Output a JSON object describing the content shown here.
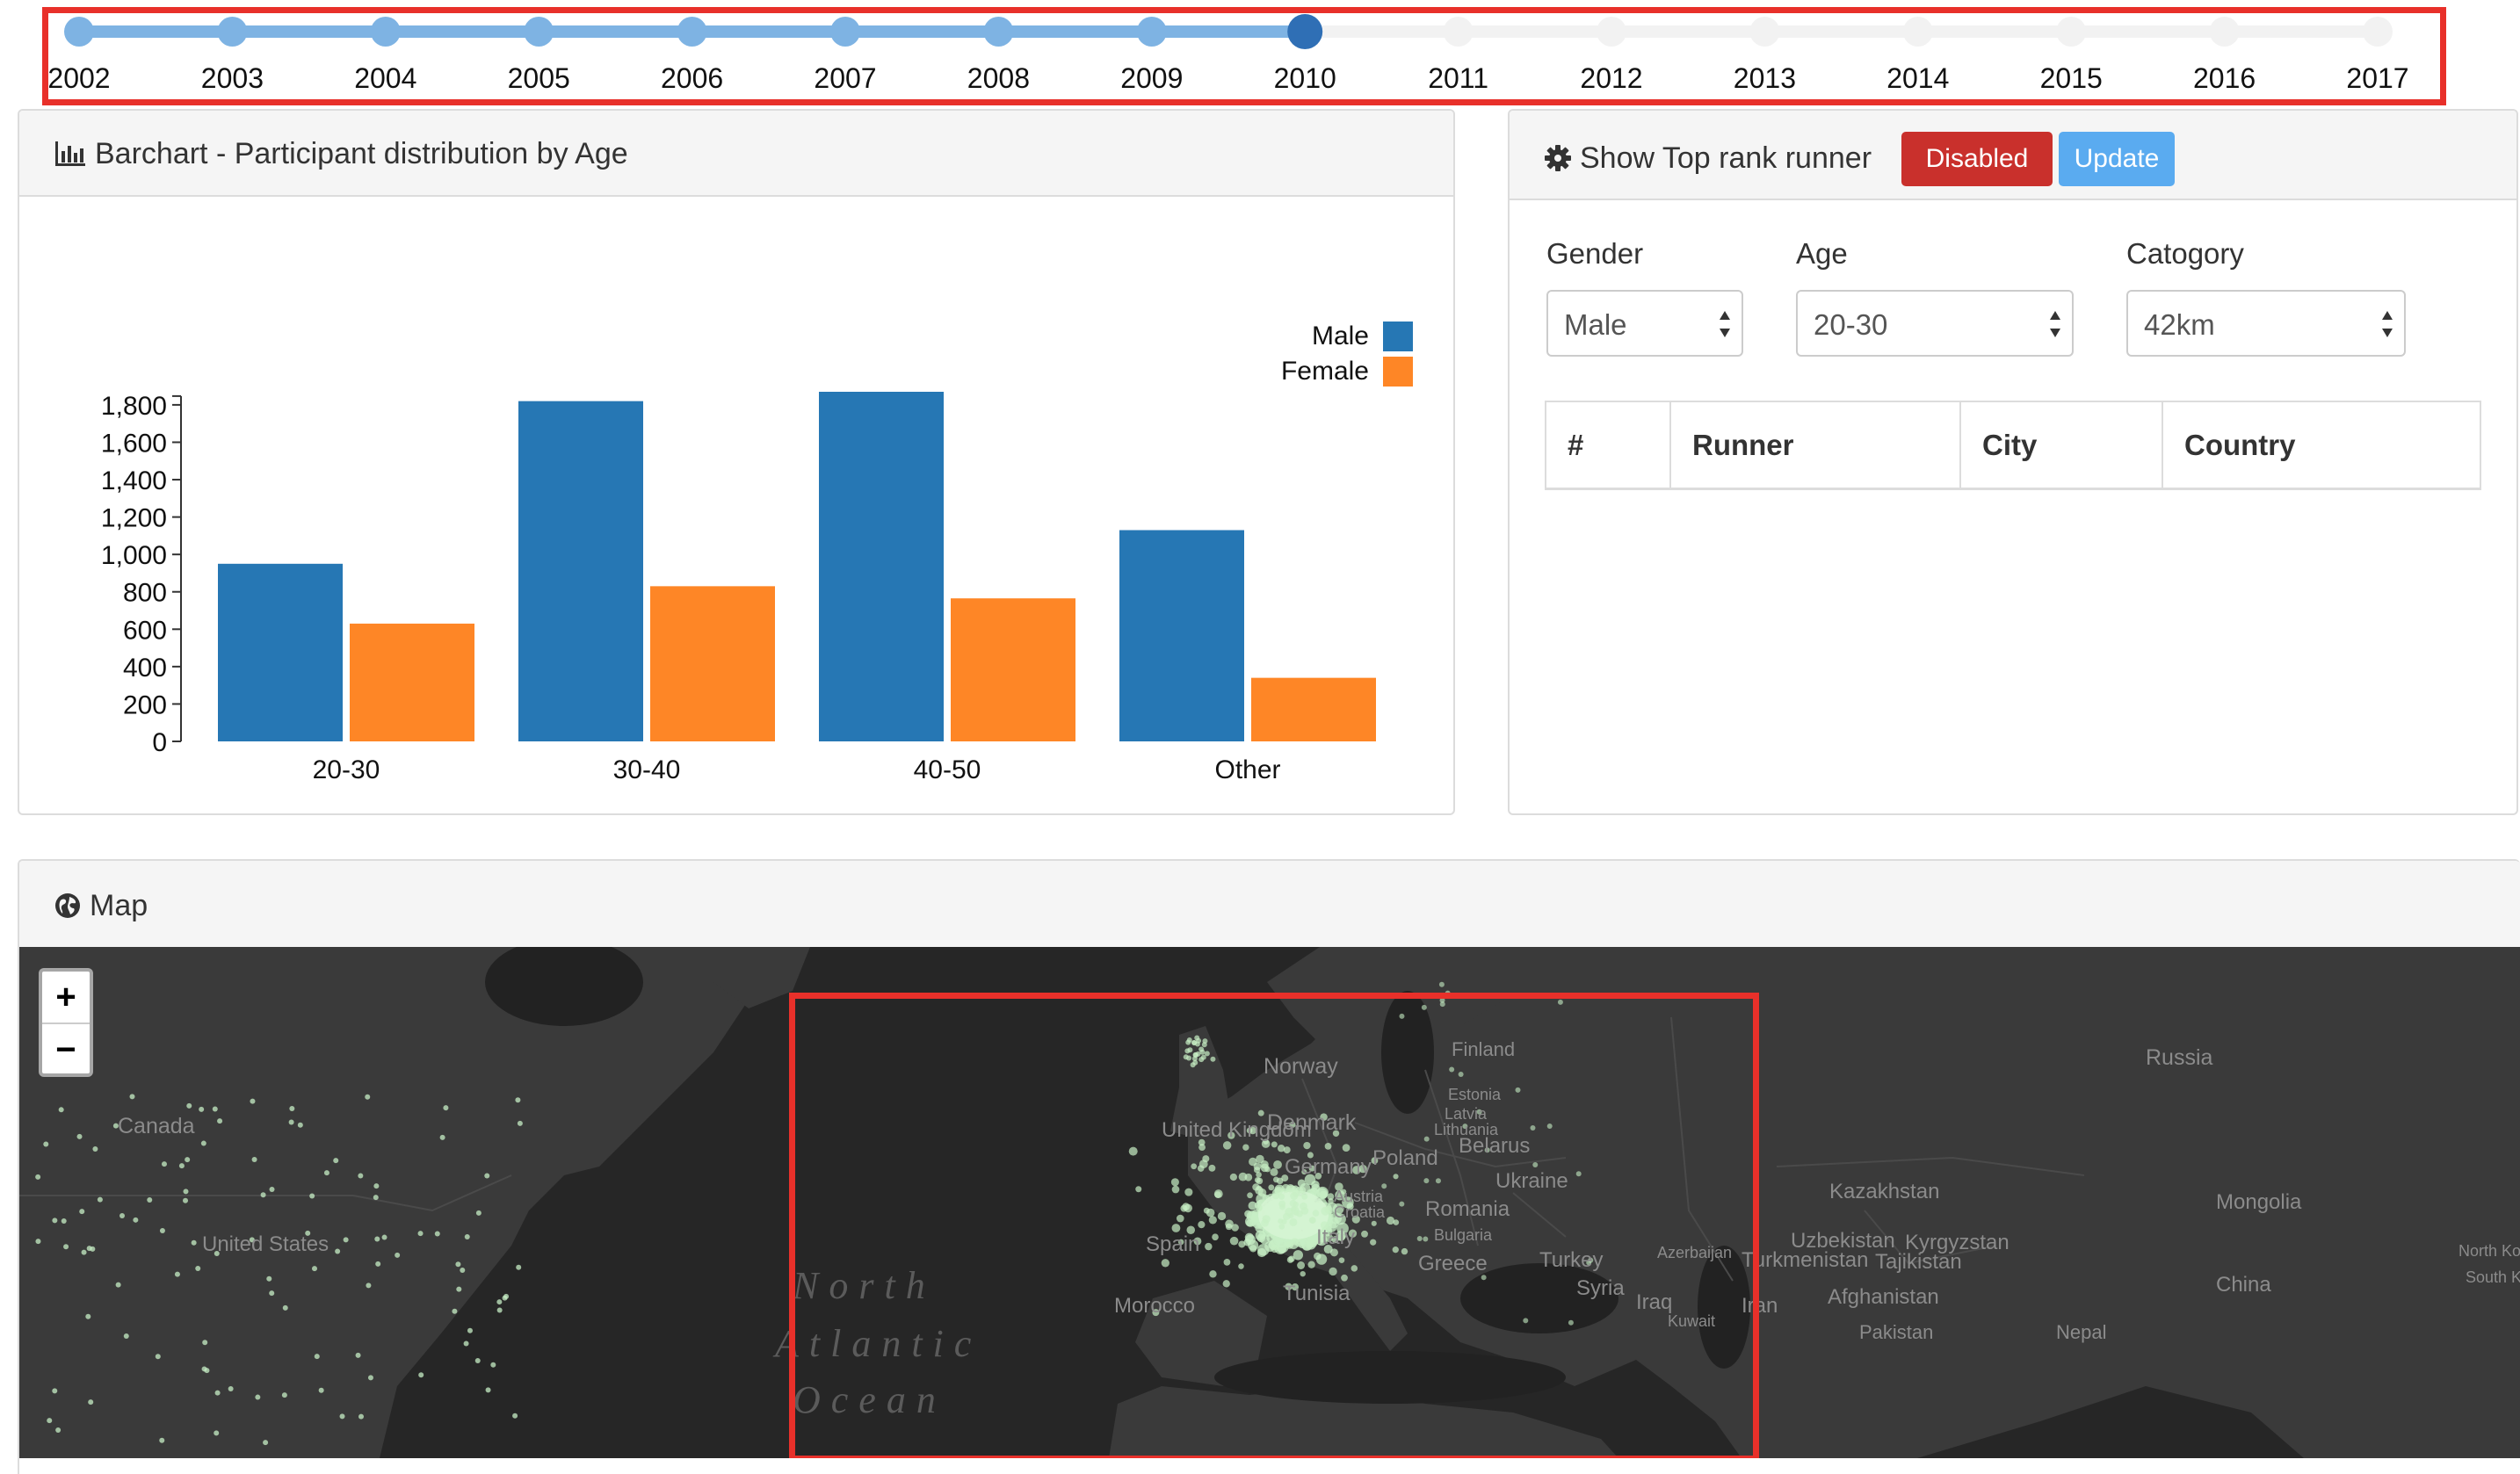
{
  "timeline": {
    "years": [
      "2002",
      "2003",
      "2004",
      "2005",
      "2006",
      "2007",
      "2008",
      "2009",
      "2010",
      "2011",
      "2012",
      "2013",
      "2014",
      "2015",
      "2016",
      "2017"
    ],
    "selected_index": 8,
    "colors": {
      "active": "#7eb3e3",
      "handle": "#2f6fb5",
      "inactive": "#f2f2f2"
    }
  },
  "barchart_panel": {
    "title": "Barchart - Participant distribution by Age",
    "icon": "bar-chart-icon"
  },
  "chart_data": {
    "type": "bar",
    "categories": [
      "20-30",
      "30-40",
      "40-50",
      "Other"
    ],
    "series": [
      {
        "name": "Male",
        "values": [
          950,
          1820,
          1870,
          1130
        ],
        "color": "#2677b4"
      },
      {
        "name": "Female",
        "values": [
          630,
          830,
          765,
          340
        ],
        "color": "#fe8626"
      }
    ],
    "yticks": [
      0,
      200,
      400,
      600,
      800,
      1000,
      1200,
      1400,
      1600,
      1800
    ],
    "ylim": [
      0,
      1870
    ],
    "legend": "top-right"
  },
  "top_rank_panel": {
    "title": "Show Top rank runner",
    "icon": "gear-icon",
    "disabled_label": "Disabled",
    "update_label": "Update",
    "disabled_color": "#c9302c",
    "update_color": "#5aabf0",
    "filters": [
      {
        "label": "Gender",
        "value": "Male"
      },
      {
        "label": "Age",
        "value": "20-30"
      },
      {
        "label": "Catogory",
        "value": "42km"
      }
    ],
    "table_headers": [
      "#",
      "Runner",
      "City",
      "Country"
    ]
  },
  "map_panel": {
    "title": "Map",
    "icon": "globe-icon",
    "zoom_in": "+",
    "zoom_out": "−",
    "labels": [
      "Norway",
      "Russia",
      "Canada",
      "Denmark",
      "United Kingdom",
      "Belarus",
      "Poland",
      "Lithuania",
      "Latvia",
      "Estonia",
      "Finland",
      "Germany",
      "Ukraine",
      "Romania",
      "Bulgaria",
      "Croatia",
      "Austria",
      "Italy",
      "Spain",
      "Greece",
      "Turkey",
      "Syria",
      "Iraq",
      "Iran",
      "Tunisia",
      "Morocco",
      "Kazakhstan",
      "Uzbekistan",
      "Kyrgyzstan",
      "Turkmenistan",
      "Tajikistan",
      "Afghanistan",
      "Azerbaijan",
      "Mongolia",
      "China",
      "North Korea",
      "South Korea",
      "Nepal",
      "Pakistan",
      "Kuwait",
      "United States"
    ],
    "ocean": [
      "North",
      "Atlantic",
      "Ocean"
    ]
  }
}
